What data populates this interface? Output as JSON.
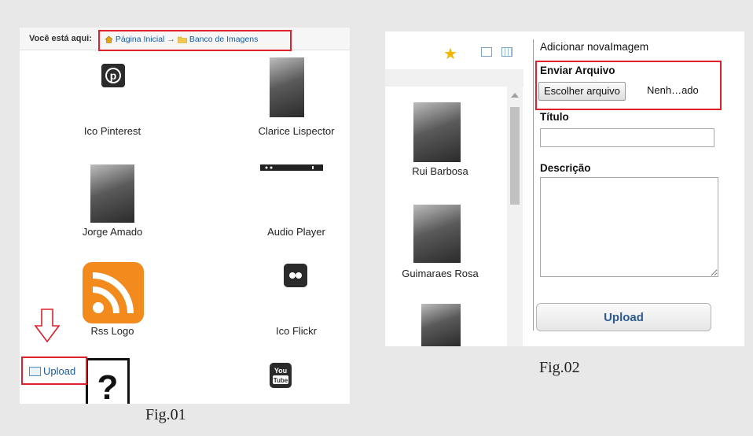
{
  "fig1": {
    "breadcrumb_label": "Você está aqui:",
    "breadcrumb_home": "Página Inicial",
    "breadcrumb_arrow": "→",
    "breadcrumb_current": "Banco de Imagens",
    "tiles": [
      "Ico Pinterest",
      "Clarice Lispector",
      "Jorge Amado",
      "Audio Player",
      "Rss Logo",
      "Ico Flickr"
    ],
    "upload_link": "Upload",
    "caption": "Fig.01"
  },
  "fig2": {
    "title": "Adicionar novaImagem",
    "send_file_label": "Enviar Arquivo",
    "choose_file_button": "Escolher arquivo",
    "file_status": "Nenh…ado",
    "title_label": "Título",
    "title_value": "",
    "description_label": "Descrição",
    "description_value": "",
    "upload_button": "Upload",
    "images": [
      "Rui Barbosa",
      "Guimaraes Rosa"
    ],
    "caption": "Fig.02"
  },
  "colors": {
    "highlight": "#e0202b",
    "link": "#1a5a9e",
    "rss": "#f28a1e",
    "star": "#f2b600"
  }
}
